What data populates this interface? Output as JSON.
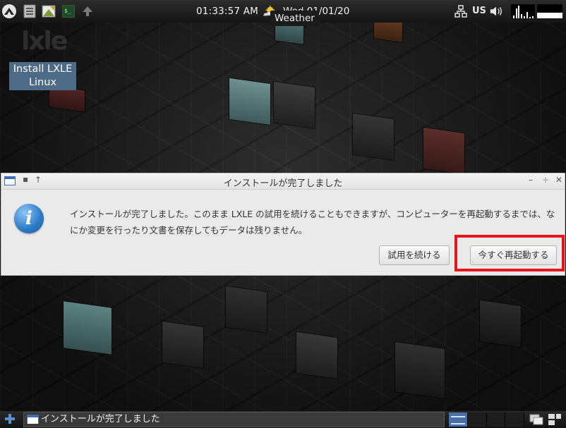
{
  "top_panel": {
    "clock": "01:33:57 AM",
    "date": "Wed 01/01/20",
    "weather_tooltip": "Weather",
    "keyboard_layout": "US"
  },
  "desktop": {
    "icon_label": "Install LXLE Linux",
    "logo_text": "lxle"
  },
  "dialog": {
    "title": "インストールが完了しました",
    "message": "インストールが完了しました。このまま LXLE の試用を続けることもできますが、コンピューターを再起動するまでは、なにか変更を行ったり文書を保存してもデータは残りません。",
    "continue_button": "試用を続ける",
    "restart_button": "今すぐ再起動する",
    "info_glyph": "i"
  },
  "taskbar": {
    "task_label": "インストールが完了しました"
  },
  "colors": {
    "highlight": "#e8141c",
    "desktop_icon_bg": "#4d6a86",
    "active_desk": "#4a6fa5"
  },
  "icons": [
    "lxle-menu-icon",
    "file-manager-icon",
    "image-viewer-icon",
    "terminal-icon",
    "arrow-up-icon",
    "weather-icon",
    "network-icon",
    "volume-icon",
    "window-menu-icon",
    "plus-icon",
    "show-desktop-icon",
    "window-switch-icon"
  ]
}
